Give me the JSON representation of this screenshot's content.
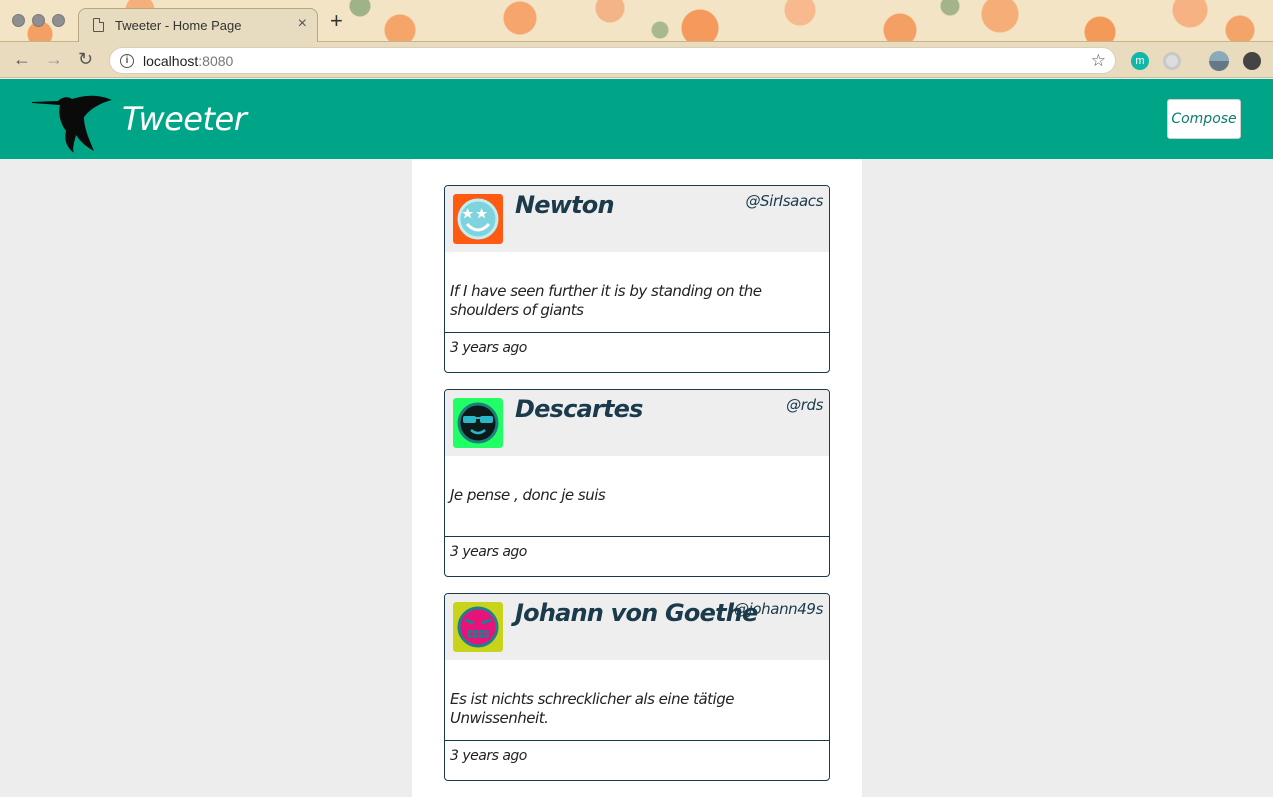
{
  "browser": {
    "tab_title": "Tweeter - Home Page",
    "tab_close": "×",
    "new_tab": "+",
    "url_host": "localhost",
    "url_port": ":8080",
    "back": "←",
    "forward": "→",
    "reload": "↻",
    "star": "☆",
    "info": "i"
  },
  "header": {
    "title": "Tweeter",
    "compose_label": "Compose",
    "brand_color": "#00a487"
  },
  "tweets": [
    {
      "name": "Newton",
      "handle": "@SirIsaacs",
      "text": "If I have seen further it is by standing on the shoulders of giants",
      "time": "3 years ago",
      "avatar_bg": "#ff5a11",
      "avatar_face": "#7fd3dd",
      "avatar_icon": "star-eyes-avatar-icon"
    },
    {
      "name": "Descartes",
      "handle": "@rds",
      "text": "Je pense , donc je suis",
      "time": "3 years ago",
      "avatar_bg": "#22ff66",
      "avatar_face": "#0c1a1a",
      "avatar_icon": "sunglasses-avatar-icon"
    },
    {
      "name": "Johann von Goethe",
      "handle": "@johann49s",
      "text": "Es ist nichts schrecklicher als eine tätige Unwissenheit.",
      "time": "3 years ago",
      "avatar_bg": "#c8d31c",
      "avatar_face": "#e8137a",
      "avatar_icon": "grimace-avatar-icon"
    }
  ]
}
